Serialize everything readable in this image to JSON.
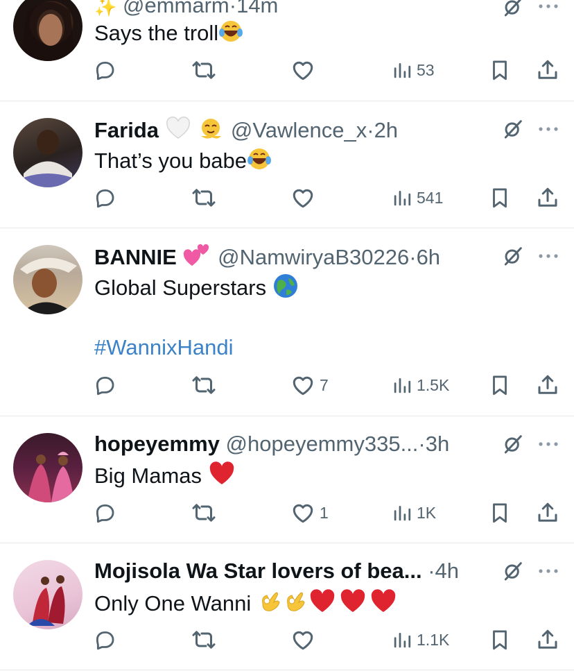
{
  "tweets": [
    {
      "name": "",
      "handle": "@emmarm",
      "dot": "·",
      "time": "14m",
      "text": "Says the troll",
      "hashtag": "",
      "replies": "",
      "retweets": "",
      "likes": "",
      "views": "53"
    },
    {
      "name": "Farida",
      "handle": "@Vawlence_x",
      "dot": "·",
      "time": "2h",
      "text": "That’s you babe",
      "hashtag": "",
      "replies": "",
      "retweets": "",
      "likes": "",
      "views": "541"
    },
    {
      "name": "BANNIE",
      "handle": "@NamwiryaB30226",
      "dot": "·",
      "time": "6h",
      "text": "Global Superstars",
      "hashtag": "#WannixHandi",
      "replies": "",
      "retweets": "",
      "likes": "7",
      "views": "1.5K"
    },
    {
      "name": "hopeyemmy",
      "handle": "@hopeyemmy335...",
      "dot": "·",
      "time": "3h",
      "text": "Big Mamas",
      "hashtag": "",
      "replies": "",
      "retweets": "",
      "likes": "1",
      "views": "1K"
    },
    {
      "name": "Mojisola Wa Star lovers of bea...",
      "handle": "",
      "dot": "·",
      "time": "4h",
      "text": "Only One Wanni",
      "hashtag": "",
      "replies": "",
      "retweets": "",
      "likes": "",
      "views": "1.1K"
    }
  ],
  "colors": {
    "text": "#0f1419",
    "secondary": "#536471",
    "hashtag": "#3b82c8",
    "divider": "#e6e8ea",
    "heart_red": "#e0242f"
  },
  "icons": [
    "reply-icon",
    "retweet-icon",
    "like-icon",
    "views-icon",
    "bookmark-icon",
    "share-icon",
    "grok-icon",
    "more-icon"
  ]
}
